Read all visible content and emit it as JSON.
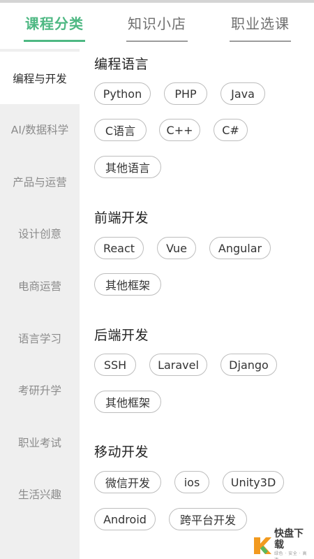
{
  "tabs": [
    {
      "label": "课程分类",
      "active": true
    },
    {
      "label": "知识小店",
      "active": false
    },
    {
      "label": "职业选课",
      "active": false
    }
  ],
  "sidebar": {
    "items": [
      {
        "label": "编程与开发",
        "active": true
      },
      {
        "label": "AI/数据科学",
        "active": false
      },
      {
        "label": "产品与运营",
        "active": false
      },
      {
        "label": "设计创意",
        "active": false
      },
      {
        "label": "电商运营",
        "active": false
      },
      {
        "label": "语言学习",
        "active": false
      },
      {
        "label": "考研升学",
        "active": false
      },
      {
        "label": "职业考试",
        "active": false
      },
      {
        "label": "生活兴趣",
        "active": false
      }
    ]
  },
  "sections": [
    {
      "title": "编程语言",
      "tags": [
        "Python",
        "PHP",
        "Java",
        "C语言",
        "C++",
        "C#",
        "其他语言"
      ]
    },
    {
      "title": "前端开发",
      "tags": [
        "React",
        "Vue",
        "Angular",
        "其他框架"
      ]
    },
    {
      "title": "后端开发",
      "tags": [
        "SSH",
        "Laravel",
        "Django",
        "其他框架"
      ]
    },
    {
      "title": "移动开发",
      "tags": [
        "微信开发",
        "ios",
        "Unity3D",
        "Android",
        "跨平台开发"
      ]
    }
  ],
  "watermark": {
    "main": "快盘下载",
    "sub": "绿色 · 安全 · 高速",
    "logo_char": "K"
  },
  "colors": {
    "accent": "#4eb883",
    "sidebar_bg": "#efefef",
    "tag_border": "#bdbdbd",
    "logo_orange": "#f29a1f",
    "logo_green": "#5cb85c"
  }
}
